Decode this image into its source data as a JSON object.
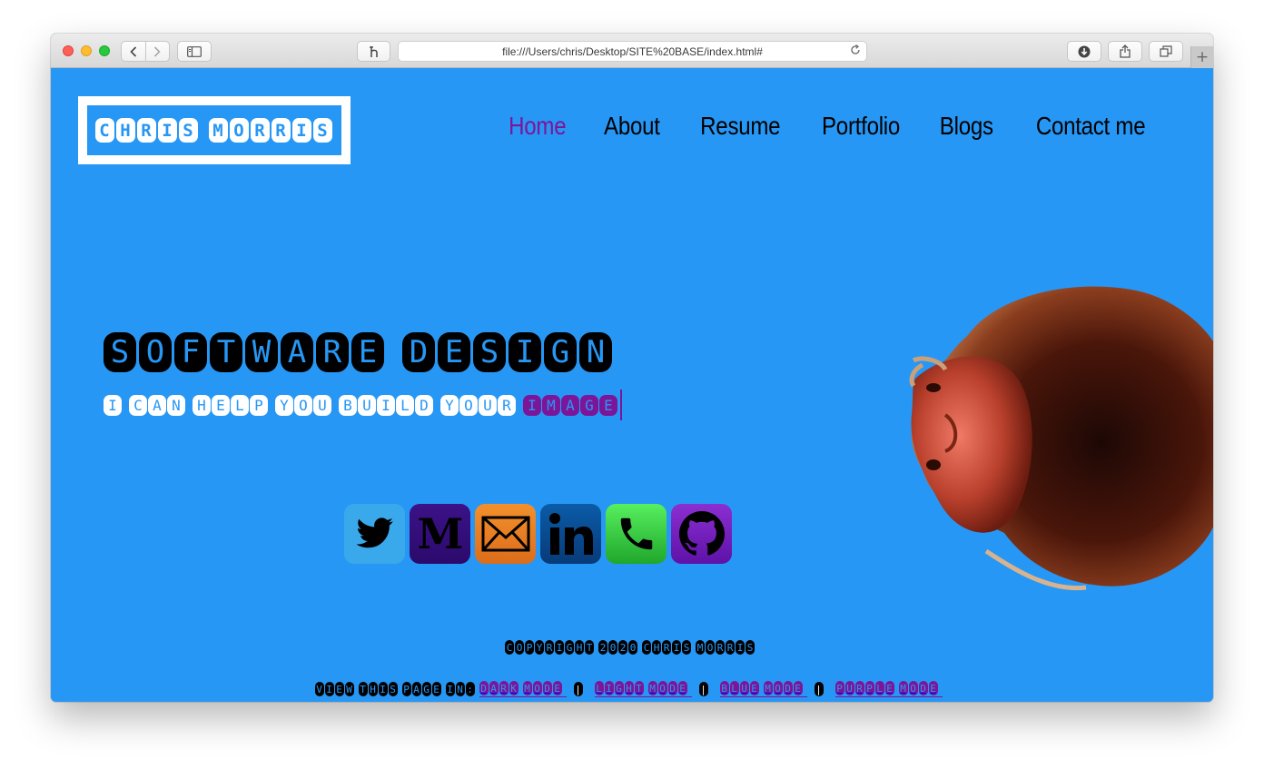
{
  "browser": {
    "url": "file:///Users/chris/Desktop/SITE%20BASE/index.html#"
  },
  "site": {
    "logo": "CHRIS MORRIS",
    "nav": [
      "Home",
      "About",
      "Resume",
      "Portfolio",
      "Blogs",
      "Contact me"
    ],
    "active_nav": "Home",
    "headline": "SOFTWARE DESIGN",
    "subline_prefix": "I CAN HELP YOU BUILD YOUR",
    "subline_highlight": "IMAGE",
    "social": [
      "twitter",
      "medium",
      "email",
      "linkedin",
      "phone",
      "github"
    ],
    "copyright": "COPYRIGHT 2020 CHRIS MORRIS",
    "view_prefix": "VIEW THIS PAGE IN:",
    "modes": [
      "DARK MODE",
      "LIGHT MODE",
      "BLUE MODE",
      "PURPLE MODE"
    ],
    "separator": "|"
  },
  "colors": {
    "page_bg": "#2797f5",
    "accent": "#7d1599"
  },
  "icons": {
    "toolbar": [
      "back-icon",
      "forward-icon",
      "sidebar-icon",
      "reader-icon",
      "reload-icon",
      "download-icon",
      "share-icon",
      "tabs-icon",
      "plus-icon"
    ]
  }
}
